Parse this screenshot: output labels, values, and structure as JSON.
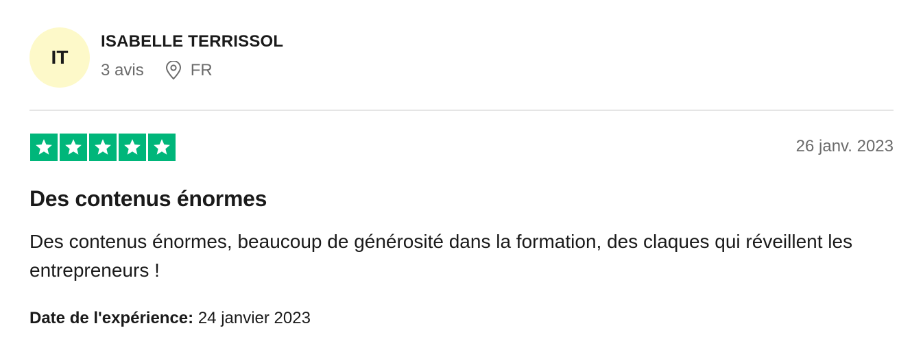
{
  "reviewer": {
    "initials": "IT",
    "name": "ISABELLE TERRISSOL",
    "review_count": "3 avis",
    "country": "FR",
    "avatar_color": "#fdf9c9"
  },
  "review": {
    "rating": 5,
    "max_rating": 5,
    "star_color": "#00b67a",
    "date": "26 janv. 2023",
    "title": "Des contenus énormes",
    "body": "Des contenus énormes, beaucoup de générosité dans la formation, des claques qui réveillent les entrepreneurs !",
    "experience_label": "Date de l'expérience:",
    "experience_date": "24 janvier 2023"
  },
  "icons": {
    "location": "location-pin-icon",
    "star": "star-icon"
  }
}
